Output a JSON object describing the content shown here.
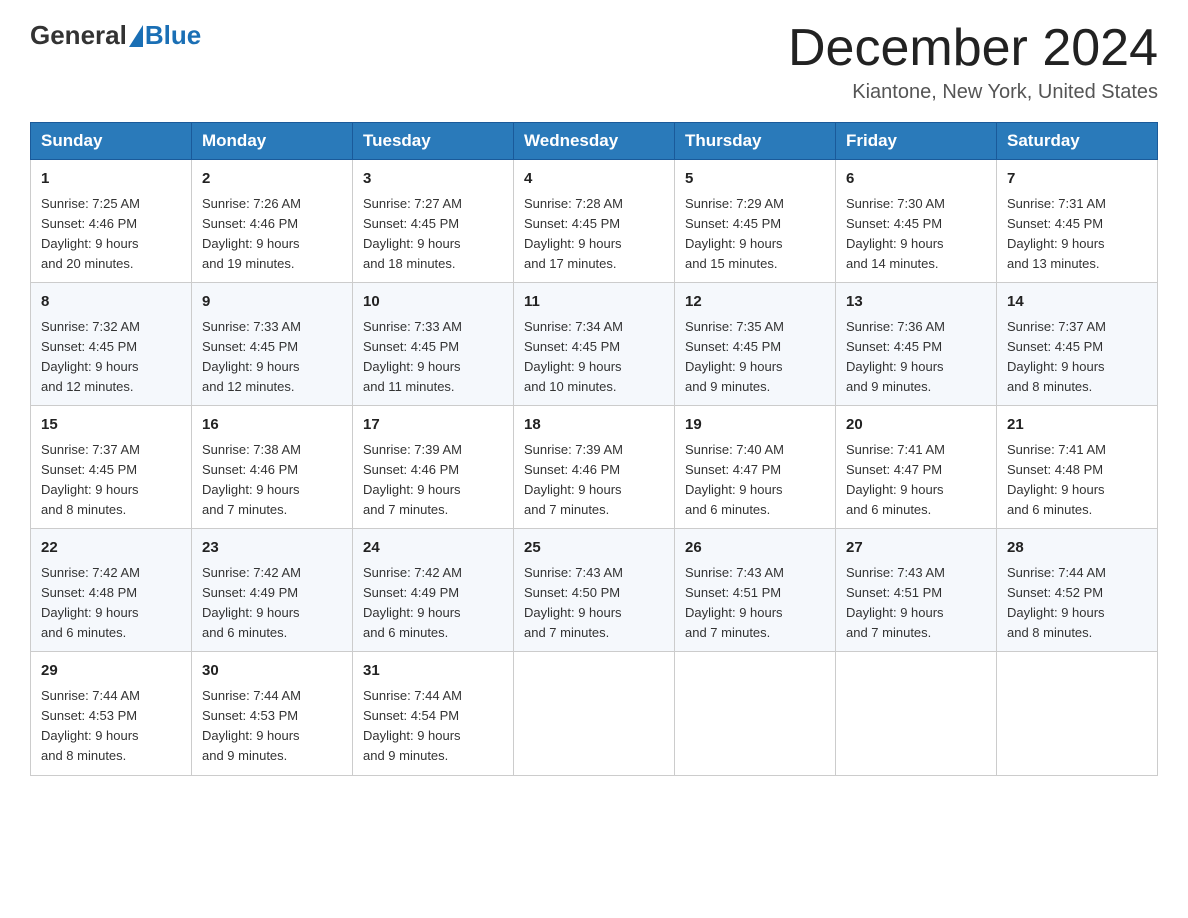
{
  "header": {
    "logo_general": "General",
    "logo_blue": "Blue",
    "month_title": "December 2024",
    "location": "Kiantone, New York, United States"
  },
  "days_of_week": [
    "Sunday",
    "Monday",
    "Tuesday",
    "Wednesday",
    "Thursday",
    "Friday",
    "Saturday"
  ],
  "weeks": [
    [
      {
        "day": "1",
        "sunrise": "7:25 AM",
        "sunset": "4:46 PM",
        "daylight": "9 hours and 20 minutes."
      },
      {
        "day": "2",
        "sunrise": "7:26 AM",
        "sunset": "4:46 PM",
        "daylight": "9 hours and 19 minutes."
      },
      {
        "day": "3",
        "sunrise": "7:27 AM",
        "sunset": "4:45 PM",
        "daylight": "9 hours and 18 minutes."
      },
      {
        "day": "4",
        "sunrise": "7:28 AM",
        "sunset": "4:45 PM",
        "daylight": "9 hours and 17 minutes."
      },
      {
        "day": "5",
        "sunrise": "7:29 AM",
        "sunset": "4:45 PM",
        "daylight": "9 hours and 15 minutes."
      },
      {
        "day": "6",
        "sunrise": "7:30 AM",
        "sunset": "4:45 PM",
        "daylight": "9 hours and 14 minutes."
      },
      {
        "day": "7",
        "sunrise": "7:31 AM",
        "sunset": "4:45 PM",
        "daylight": "9 hours and 13 minutes."
      }
    ],
    [
      {
        "day": "8",
        "sunrise": "7:32 AM",
        "sunset": "4:45 PM",
        "daylight": "9 hours and 12 minutes."
      },
      {
        "day": "9",
        "sunrise": "7:33 AM",
        "sunset": "4:45 PM",
        "daylight": "9 hours and 12 minutes."
      },
      {
        "day": "10",
        "sunrise": "7:33 AM",
        "sunset": "4:45 PM",
        "daylight": "9 hours and 11 minutes."
      },
      {
        "day": "11",
        "sunrise": "7:34 AM",
        "sunset": "4:45 PM",
        "daylight": "9 hours and 10 minutes."
      },
      {
        "day": "12",
        "sunrise": "7:35 AM",
        "sunset": "4:45 PM",
        "daylight": "9 hours and 9 minutes."
      },
      {
        "day": "13",
        "sunrise": "7:36 AM",
        "sunset": "4:45 PM",
        "daylight": "9 hours and 9 minutes."
      },
      {
        "day": "14",
        "sunrise": "7:37 AM",
        "sunset": "4:45 PM",
        "daylight": "9 hours and 8 minutes."
      }
    ],
    [
      {
        "day": "15",
        "sunrise": "7:37 AM",
        "sunset": "4:45 PM",
        "daylight": "9 hours and 8 minutes."
      },
      {
        "day": "16",
        "sunrise": "7:38 AM",
        "sunset": "4:46 PM",
        "daylight": "9 hours and 7 minutes."
      },
      {
        "day": "17",
        "sunrise": "7:39 AM",
        "sunset": "4:46 PM",
        "daylight": "9 hours and 7 minutes."
      },
      {
        "day": "18",
        "sunrise": "7:39 AM",
        "sunset": "4:46 PM",
        "daylight": "9 hours and 7 minutes."
      },
      {
        "day": "19",
        "sunrise": "7:40 AM",
        "sunset": "4:47 PM",
        "daylight": "9 hours and 6 minutes."
      },
      {
        "day": "20",
        "sunrise": "7:41 AM",
        "sunset": "4:47 PM",
        "daylight": "9 hours and 6 minutes."
      },
      {
        "day": "21",
        "sunrise": "7:41 AM",
        "sunset": "4:48 PM",
        "daylight": "9 hours and 6 minutes."
      }
    ],
    [
      {
        "day": "22",
        "sunrise": "7:42 AM",
        "sunset": "4:48 PM",
        "daylight": "9 hours and 6 minutes."
      },
      {
        "day": "23",
        "sunrise": "7:42 AM",
        "sunset": "4:49 PM",
        "daylight": "9 hours and 6 minutes."
      },
      {
        "day": "24",
        "sunrise": "7:42 AM",
        "sunset": "4:49 PM",
        "daylight": "9 hours and 6 minutes."
      },
      {
        "day": "25",
        "sunrise": "7:43 AM",
        "sunset": "4:50 PM",
        "daylight": "9 hours and 7 minutes."
      },
      {
        "day": "26",
        "sunrise": "7:43 AM",
        "sunset": "4:51 PM",
        "daylight": "9 hours and 7 minutes."
      },
      {
        "day": "27",
        "sunrise": "7:43 AM",
        "sunset": "4:51 PM",
        "daylight": "9 hours and 7 minutes."
      },
      {
        "day": "28",
        "sunrise": "7:44 AM",
        "sunset": "4:52 PM",
        "daylight": "9 hours and 8 minutes."
      }
    ],
    [
      {
        "day": "29",
        "sunrise": "7:44 AM",
        "sunset": "4:53 PM",
        "daylight": "9 hours and 8 minutes."
      },
      {
        "day": "30",
        "sunrise": "7:44 AM",
        "sunset": "4:53 PM",
        "daylight": "9 hours and 9 minutes."
      },
      {
        "day": "31",
        "sunrise": "7:44 AM",
        "sunset": "4:54 PM",
        "daylight": "9 hours and 9 minutes."
      },
      null,
      null,
      null,
      null
    ]
  ]
}
